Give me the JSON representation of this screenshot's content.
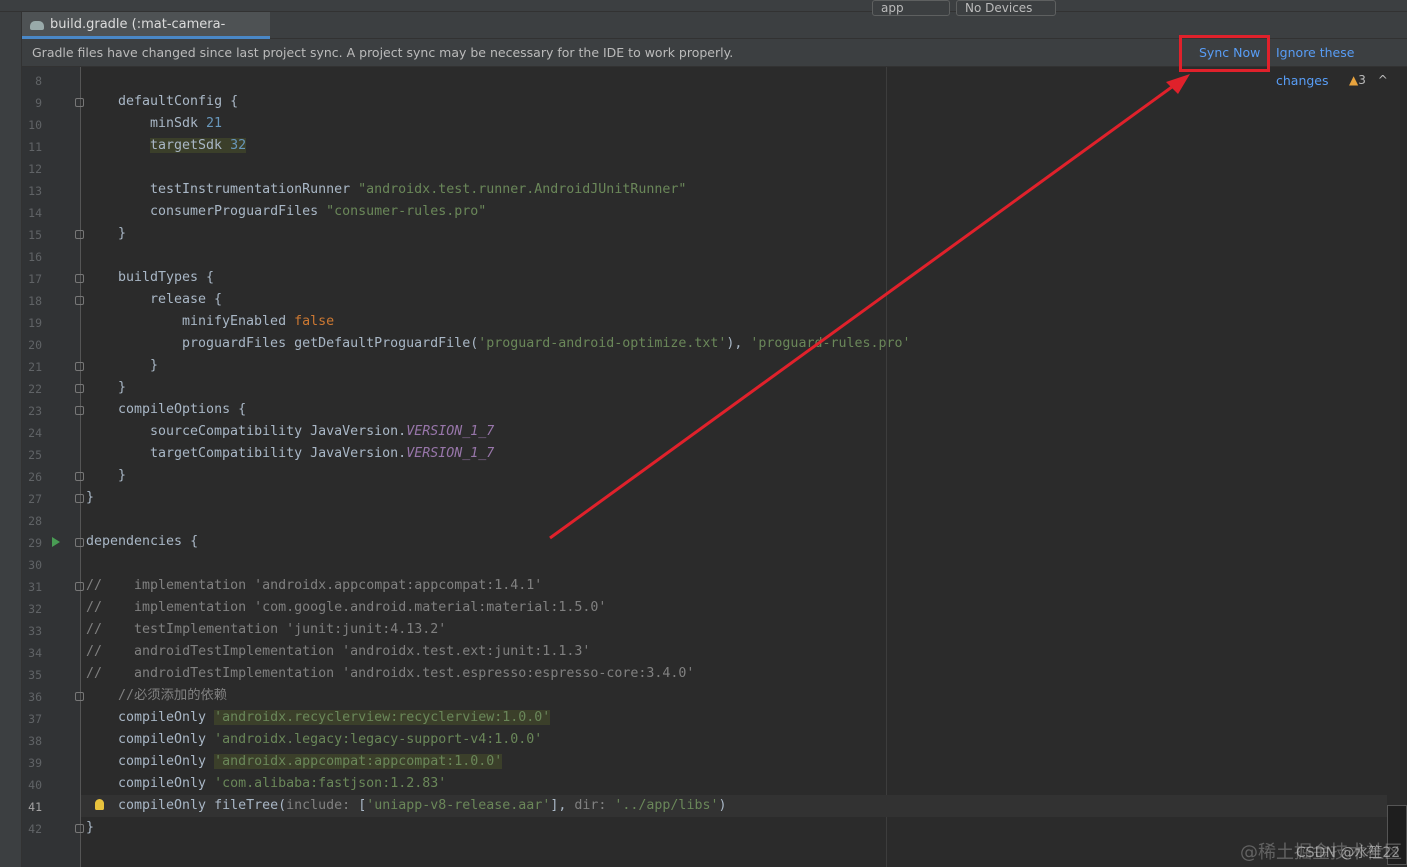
{
  "toolbar": {
    "config": "app",
    "device": "No Devices"
  },
  "tab": {
    "title": "build.gradle (:mat-camera-plugin)",
    "close": "×"
  },
  "notification": {
    "message": "Gradle files have changed since last project sync. A project sync may be necessary for the IDE to work properly.",
    "sync_now": "Sync Now",
    "ignore": "Ignore these changes"
  },
  "inspections": {
    "warnings": "3"
  },
  "watermark": {
    "text1": "@稀土掘金技术社区",
    "text2": "CSDN @水笙22"
  },
  "colors": {
    "annotation": "#e0212b",
    "link": "#589df6"
  },
  "code": {
    "first_line": 8,
    "current_line": 41,
    "lines": [
      [],
      [
        [
          4,
          "defaultConfig {"
        ]
      ],
      [
        [
          8,
          "minSdk "
        ],
        [
          "n",
          "21"
        ]
      ],
      [
        [
          8,
          ""
        ],
        [
          "hl",
          "targetSdk "
        ],
        [
          "hl n",
          "32"
        ]
      ],
      [],
      [
        [
          8,
          "testInstrumentationRunner "
        ],
        [
          "s",
          "\"androidx.test.runner.AndroidJUnitRunner\""
        ]
      ],
      [
        [
          8,
          "consumerProguardFiles "
        ],
        [
          "s",
          "\"consumer-rules.pro\""
        ]
      ],
      [
        [
          4,
          "}"
        ]
      ],
      [],
      [
        [
          4,
          "buildTypes {"
        ]
      ],
      [
        [
          8,
          "release {"
        ]
      ],
      [
        [
          12,
          "minifyEnabled "
        ],
        [
          "k",
          "false"
        ]
      ],
      [
        [
          12,
          "proguardFiles getDefaultProguardFile("
        ],
        [
          "s",
          "'proguard-android-optimize.txt'"
        ],
        [
          "",
          "), "
        ],
        [
          "s",
          "'proguard-rules.pro'"
        ]
      ],
      [
        [
          8,
          "}"
        ]
      ],
      [
        [
          4,
          "}"
        ]
      ],
      [
        [
          4,
          "compileOptions {"
        ]
      ],
      [
        [
          8,
          "sourceCompatibility JavaVersion."
        ],
        [
          "v",
          "VERSION_1_7"
        ]
      ],
      [
        [
          8,
          "targetCompatibility JavaVersion."
        ],
        [
          "v",
          "VERSION_1_7"
        ]
      ],
      [
        [
          4,
          "}"
        ]
      ],
      [
        [
          0,
          "}"
        ]
      ],
      [],
      [
        [
          0,
          "dependencies {"
        ]
      ],
      [],
      [
        [
          0,
          ""
        ],
        [
          "c",
          "//    implementation 'androidx.appcompat:appcompat:1.4.1'"
        ]
      ],
      [
        [
          0,
          ""
        ],
        [
          "c",
          "//    implementation 'com.google.android.material:material:1.5.0'"
        ]
      ],
      [
        [
          0,
          ""
        ],
        [
          "c",
          "//    testImplementation 'junit:junit:4.13.2'"
        ]
      ],
      [
        [
          0,
          ""
        ],
        [
          "c",
          "//    androidTestImplementation 'androidx.test.ext:junit:1.1.3'"
        ]
      ],
      [
        [
          0,
          ""
        ],
        [
          "c",
          "//    androidTestImplementation 'androidx.test.espresso:espresso-core:3.4.0'"
        ]
      ],
      [
        [
          4,
          ""
        ],
        [
          "c",
          "//必须添加的依赖"
        ]
      ],
      [
        [
          4,
          "compileOnly "
        ],
        [
          "hl s",
          "'androidx.recyclerview:recyclerview:1.0.0'"
        ]
      ],
      [
        [
          4,
          "compileOnly "
        ],
        [
          "s",
          "'androidx.legacy:legacy-support-v4:1.0.0'"
        ]
      ],
      [
        [
          4,
          "compileOnly "
        ],
        [
          "hl s",
          "'androidx.appcompat:appcompat:1.0.0'"
        ]
      ],
      [
        [
          4,
          "compileOnly "
        ],
        [
          "s",
          "'com.alibaba:fastjson:1.2.83'"
        ]
      ],
      [
        [
          4,
          "compileOnly fileTree("
        ],
        [
          "c",
          "include: "
        ],
        [
          "",
          "["
        ],
        [
          "s",
          "'uniapp-v8-release.aar'"
        ],
        [
          "",
          "], "
        ],
        [
          "c",
          "dir: "
        ],
        [
          "s",
          "'../app/libs'"
        ],
        [
          "",
          ")"
        ]
      ],
      [
        [
          0,
          "}"
        ]
      ]
    ]
  },
  "folds": [
    9,
    15,
    17,
    18,
    21,
    22,
    23,
    26,
    27,
    29,
    31,
    36,
    42
  ]
}
